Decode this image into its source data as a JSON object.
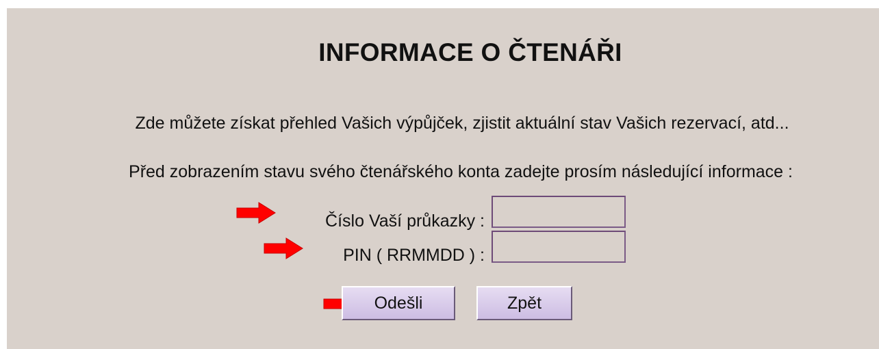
{
  "page": {
    "title": "INFORMACE O ČTENÁŘI",
    "intro": "Zde můžete získat přehled Vašich výpůjček, zjistit aktuální stav Vašich rezervací, atd...",
    "prompt": "Před zobrazením stavu svého čtenářského konta zadejte prosím následující informace :"
  },
  "form": {
    "card_number": {
      "label": "Číslo Vaší průkazky :",
      "value": ""
    },
    "pin": {
      "label": "PIN ( RRMMDD ) :",
      "value": ""
    },
    "buttons": {
      "submit_label": "Odešli",
      "back_label": "Zpět"
    }
  },
  "colors": {
    "background": "#d9d1cb",
    "input_border": "#6d4a78",
    "button_fill": "#d8cbeb",
    "arrow": "#ff0000"
  },
  "icons": {
    "pointer_arrows": [
      "arrow-right-icon",
      "arrow-right-icon",
      "arrow-right-icon"
    ]
  }
}
